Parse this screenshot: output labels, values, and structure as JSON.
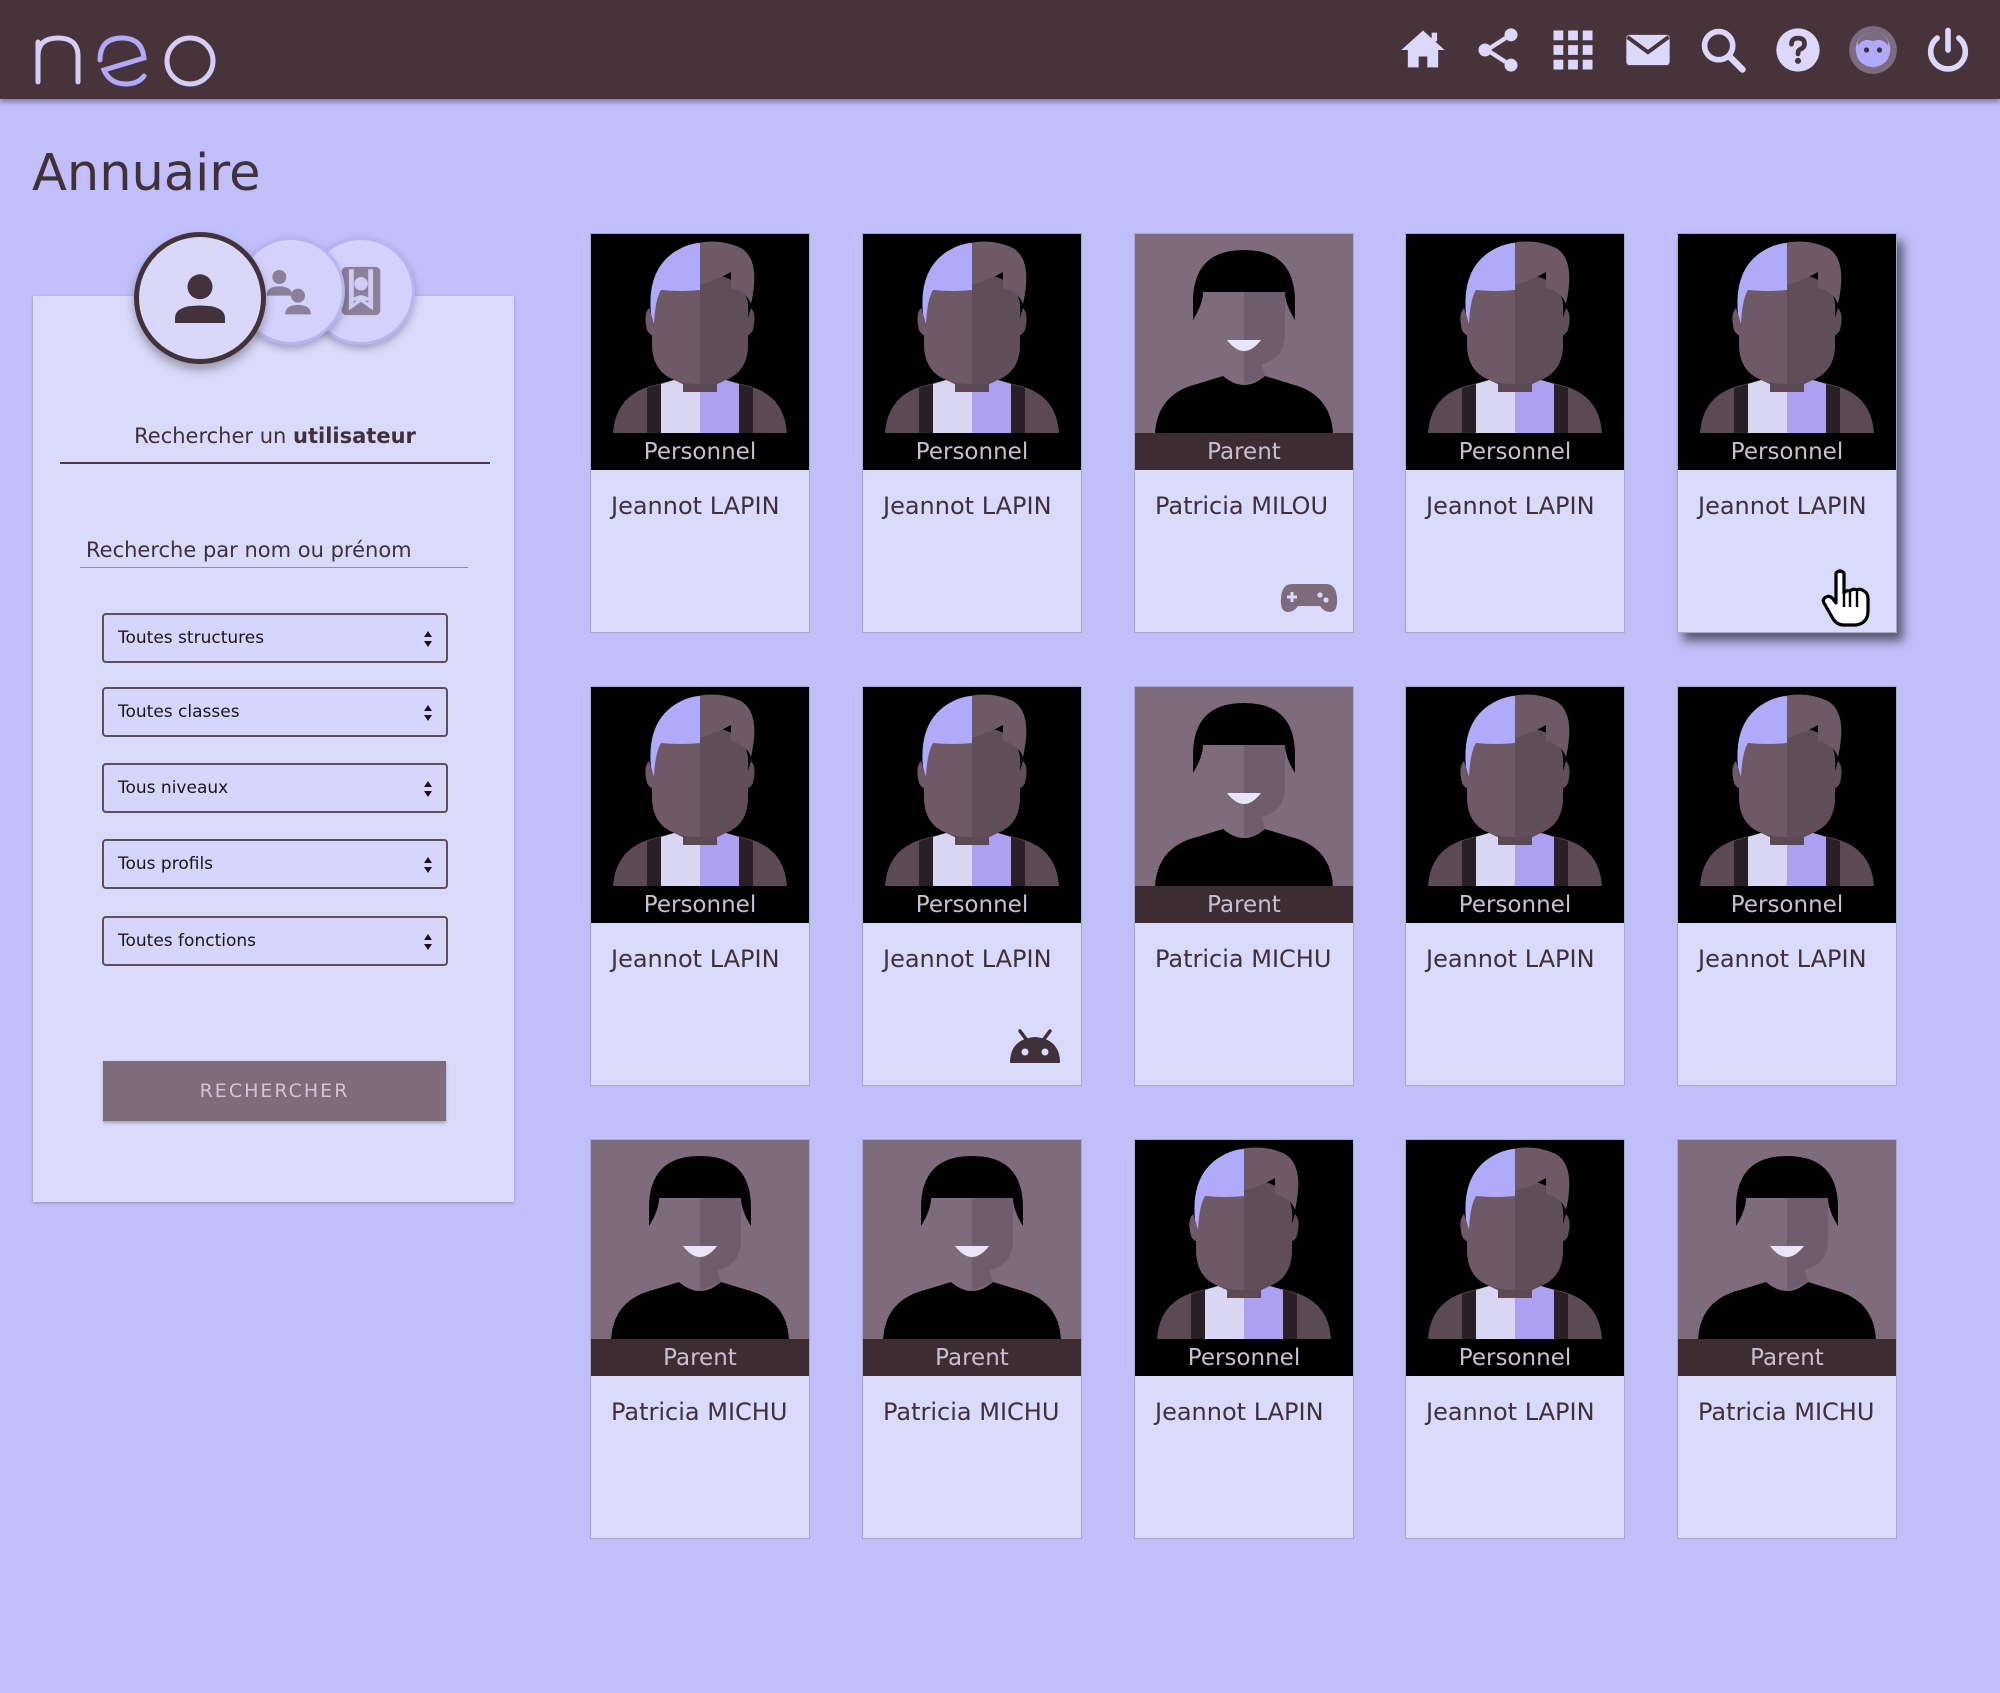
{
  "app": {
    "logo_text": "neo"
  },
  "header": {
    "icons": [
      "home-icon",
      "share-icon",
      "apps-grid-icon",
      "mail-icon",
      "search-icon",
      "help-icon",
      "user-avatar-icon",
      "power-icon"
    ]
  },
  "page": {
    "title": "Annuaire"
  },
  "search_panel": {
    "heading_prefix": "Rechercher un ",
    "heading_bold": "utilisateur",
    "search_placeholder": "Recherche par nom ou prénom",
    "filters": [
      "Toutes structures",
      "Toutes classes",
      "Tous niveaux",
      "Tous profils",
      "Toutes fonctions"
    ],
    "button_label": "RECHERCHER",
    "mode_icons": [
      "user-icon",
      "group-icon",
      "favorite-icon"
    ]
  },
  "results": [
    {
      "role": "Personnel",
      "name": "Jeannot LAPIN",
      "avatar": "staff",
      "badge": ""
    },
    {
      "role": "Personnel",
      "name": "Jeannot LAPIN",
      "avatar": "staff",
      "badge": ""
    },
    {
      "role": "Parent",
      "name": "Patricia MILOU",
      "avatar": "parent",
      "badge": "gamepad-icon"
    },
    {
      "role": "Personnel",
      "name": "Jeannot LAPIN",
      "avatar": "staff",
      "badge": ""
    },
    {
      "role": "Personnel",
      "name": "Jeannot LAPIN",
      "avatar": "staff",
      "badge": ""
    },
    {
      "role": "Personnel",
      "name": "Jeannot LAPIN",
      "avatar": "staff",
      "badge": ""
    },
    {
      "role": "Personnel",
      "name": "Jeannot LAPIN",
      "avatar": "staff",
      "badge": "android-icon"
    },
    {
      "role": "Parent",
      "name": "Patricia MICHU",
      "avatar": "parent",
      "badge": ""
    },
    {
      "role": "Personnel",
      "name": "Jeannot LAPIN",
      "avatar": "staff",
      "badge": ""
    },
    {
      "role": "Personnel",
      "name": "Jeannot LAPIN",
      "avatar": "staff",
      "badge": ""
    },
    {
      "role": "Parent",
      "name": "Patricia MICHU",
      "avatar": "parent",
      "badge": ""
    },
    {
      "role": "Parent",
      "name": "Patricia MICHU",
      "avatar": "parent",
      "badge": ""
    },
    {
      "role": "Personnel",
      "name": "Jeannot LAPIN",
      "avatar": "staff",
      "badge": ""
    },
    {
      "role": "Personnel",
      "name": "Jeannot LAPIN",
      "avatar": "staff",
      "badge": ""
    },
    {
      "role": "Parent",
      "name": "Patricia MICHU",
      "avatar": "parent",
      "badge": ""
    }
  ],
  "colors": {
    "header_bg": "#47343b",
    "page_bg": "#c1bff9",
    "card_bg": "#dadafc",
    "role_band": "#3d2d33",
    "accent": "#b1a9f9",
    "button_bg": "#7e6b7b"
  }
}
